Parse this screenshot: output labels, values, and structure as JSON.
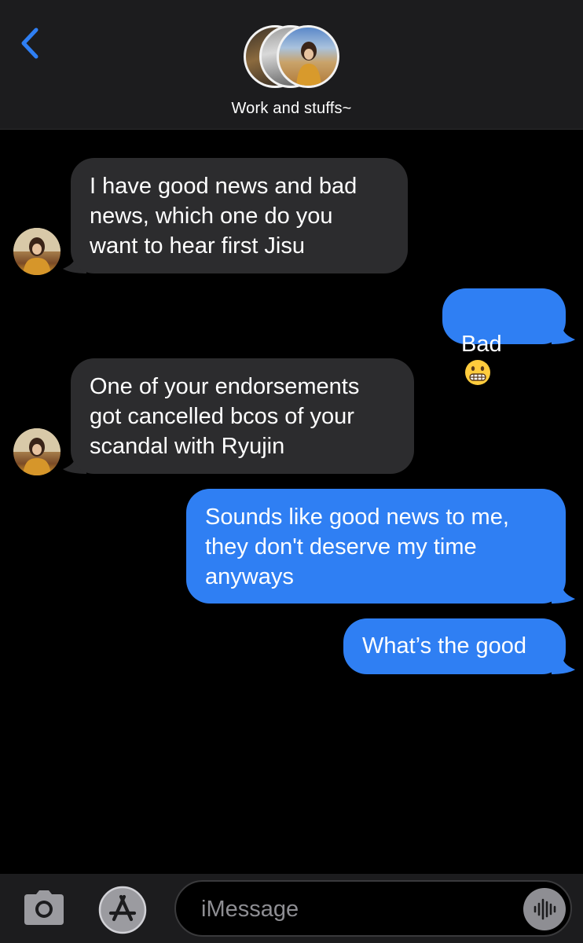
{
  "header": {
    "chat_title": "Work and stuffs~",
    "back_icon": "chevron-left-icon"
  },
  "messages": [
    {
      "direction": "incoming",
      "text": "I have good news and bad\nnews, which one do you\nwant to hear first Jisu"
    },
    {
      "direction": "outgoing",
      "text": "Bad",
      "emoji": "grimacing-face"
    },
    {
      "direction": "incoming",
      "text": "One of your endorsements\ngot cancelled bcos of your\nscandal with Ryujin"
    },
    {
      "direction": "outgoing",
      "text": "Sounds like good news to me,\nthey don't deserve my time\nanyways"
    },
    {
      "direction": "outgoing",
      "text": "What’s the good"
    }
  ],
  "input_bar": {
    "placeholder": "iMessage",
    "icons": [
      "camera-icon",
      "app-store-icon",
      "audio-waveform-icon"
    ]
  },
  "colors": {
    "accent": "#2f7ff3",
    "incoming_bubble": "#2c2c2e",
    "background": "#000000",
    "bar": "#1c1c1e"
  }
}
